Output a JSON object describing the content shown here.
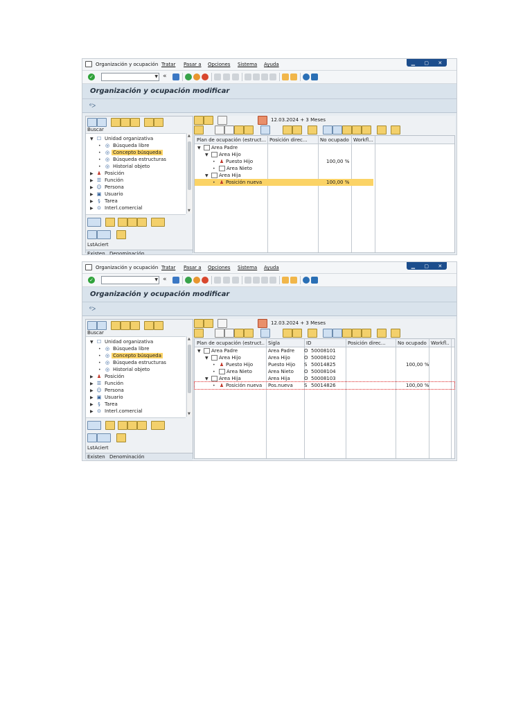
{
  "menu": {
    "items": [
      "Organización y ocupación",
      "Tratar",
      "Pasar a",
      "Opciones",
      "Sistema",
      "Ayuda"
    ],
    "window_buttons": [
      "▁",
      "▢",
      "✕"
    ]
  },
  "toolbar": {
    "back_glyph": "«",
    "icons": [
      "save-icon",
      "back-icon",
      "exit-icon",
      "cancel-icon",
      "print-icon",
      "find-icon",
      "find-next-icon",
      "first-page-icon",
      "prev-page-icon",
      "next-page-icon",
      "last-page-icon",
      "new-session-icon",
      "shortcut-icon",
      "help-icon",
      "layout-icon"
    ]
  },
  "screen": {
    "title": "Organización y ocupación modificar"
  },
  "left": {
    "search_label": "Buscar",
    "tree": [
      {
        "label": "Unidad organizativa",
        "level": 0,
        "expanded": true,
        "icon": "org-unit-icon"
      },
      {
        "label": "Búsqueda libre",
        "level": 1,
        "icon": "binoculars-icon"
      },
      {
        "label": "Concepto búsqueda",
        "level": 1,
        "icon": "binoculars-icon",
        "selected": true
      },
      {
        "label": "Búsqueda estructuras",
        "level": 1,
        "icon": "binoculars-icon"
      },
      {
        "label": "Historial objeto",
        "level": 1,
        "icon": "binoculars-icon"
      },
      {
        "label": "Posición",
        "level": 0,
        "icon": "position-icon"
      },
      {
        "label": "Función",
        "level": 0,
        "icon": "function-icon"
      },
      {
        "label": "Persona",
        "level": 0,
        "icon": "person-icon"
      },
      {
        "label": "Usuario",
        "level": 0,
        "icon": "user-icon"
      },
      {
        "label": "Tarea",
        "level": 0,
        "icon": "task-icon"
      },
      {
        "label": "Interl.comercial",
        "level": 0,
        "icon": "partner-icon"
      }
    ],
    "list_label": "LstAciert",
    "list_columns": [
      "Existen",
      "Denominación"
    ]
  },
  "right": {
    "date": "12.03.2024",
    "period": "+ 3 Meses"
  },
  "screen1": {
    "columns": [
      "Plan de ocupación (estruct...",
      "Posición direc...",
      "No ocupado",
      "Workfl..."
    ],
    "rows": [
      {
        "name": "Area Padre",
        "level": 0,
        "type": "folder",
        "expanded": true,
        "no_ocupado": ""
      },
      {
        "name": "Area Hijo",
        "level": 1,
        "type": "folder",
        "expanded": true,
        "no_ocupado": ""
      },
      {
        "name": "Puesto Hijo",
        "level": 2,
        "type": "position",
        "no_ocupado": "100,00 %"
      },
      {
        "name": "Area Nieto",
        "level": 2,
        "type": "folder",
        "no_ocupado": ""
      },
      {
        "name": "Area Hija",
        "level": 1,
        "type": "folder",
        "expanded": true,
        "no_ocupado": ""
      },
      {
        "name": "Posición nueva",
        "level": 2,
        "type": "position",
        "selected": true,
        "no_ocupado": "100,00 %"
      }
    ]
  },
  "screen2": {
    "columns": [
      "Plan de ocupación (estruct...",
      "Sigla",
      "ID",
      "Posición direc...",
      "No ocupado",
      "Workfl..."
    ],
    "rows": [
      {
        "name": "Area Padre",
        "level": 0,
        "type": "folder",
        "expanded": true,
        "sigla": "Area Padre",
        "otype": "O",
        "id": "50008101",
        "no_ocupado": ""
      },
      {
        "name": "Area Hijo",
        "level": 1,
        "type": "folder",
        "expanded": true,
        "sigla": "Area Hijo",
        "otype": "O",
        "id": "50008102",
        "no_ocupado": ""
      },
      {
        "name": "Puesto Hijo",
        "level": 2,
        "type": "position",
        "sigla": "Puesto Hijo",
        "otype": "S",
        "id": "50014825",
        "no_ocupado": "100,00 %"
      },
      {
        "name": "Area Nieto",
        "level": 2,
        "type": "folder",
        "sigla": "Area Nieto",
        "otype": "O",
        "id": "50008104",
        "no_ocupado": ""
      },
      {
        "name": "Area Hija",
        "level": 1,
        "type": "folder",
        "expanded": true,
        "sigla": "Area Hija",
        "otype": "O",
        "id": "50008103",
        "no_ocupado": ""
      },
      {
        "name": "Posición nueva",
        "level": 2,
        "type": "position",
        "sigla": "Pos.nueva",
        "otype": "S",
        "id": "50014826",
        "no_ocupado": "100,00 %"
      }
    ]
  }
}
